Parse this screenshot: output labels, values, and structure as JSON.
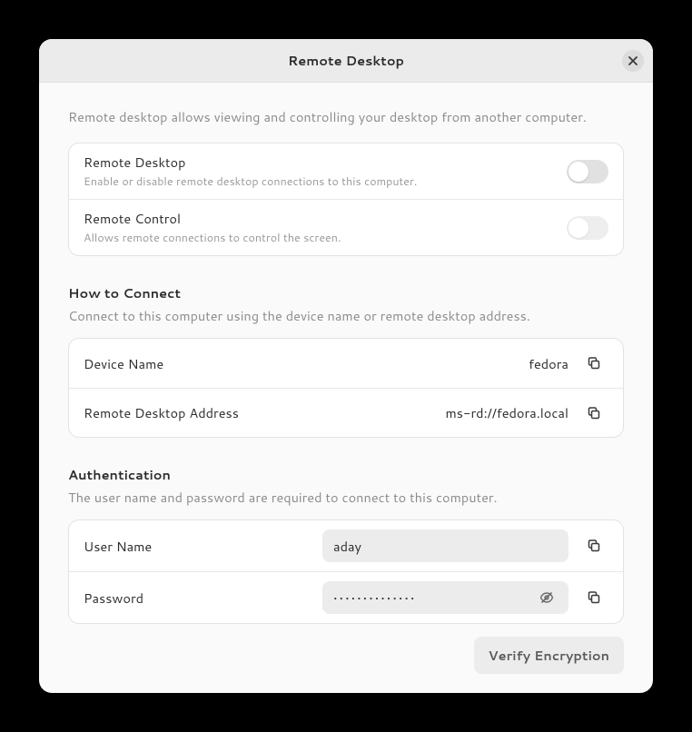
{
  "header": {
    "title": "Remote Desktop"
  },
  "intro": "Remote desktop allows viewing and controlling your desktop from another computer.",
  "toggles": {
    "remote_desktop": {
      "label": "Remote Desktop",
      "sub": "Enable or disable remote desktop connections to this computer.",
      "enabled": false
    },
    "remote_control": {
      "label": "Remote Control",
      "sub": "Allows remote connections to control the screen.",
      "enabled": false
    }
  },
  "connect": {
    "title": "How to Connect",
    "sub": "Connect to this computer using the device name or remote desktop address.",
    "device_name": {
      "label": "Device Name",
      "value": "fedora"
    },
    "address": {
      "label": "Remote Desktop Address",
      "value": "ms-rd://fedora.local"
    }
  },
  "auth": {
    "title": "Authentication",
    "sub": "The user name and password are required to connect to this computer.",
    "username": {
      "label": "User Name",
      "value": "aday"
    },
    "password": {
      "label": "Password",
      "value": "••••••••••••••"
    },
    "verify_label": "Verify Encryption"
  }
}
